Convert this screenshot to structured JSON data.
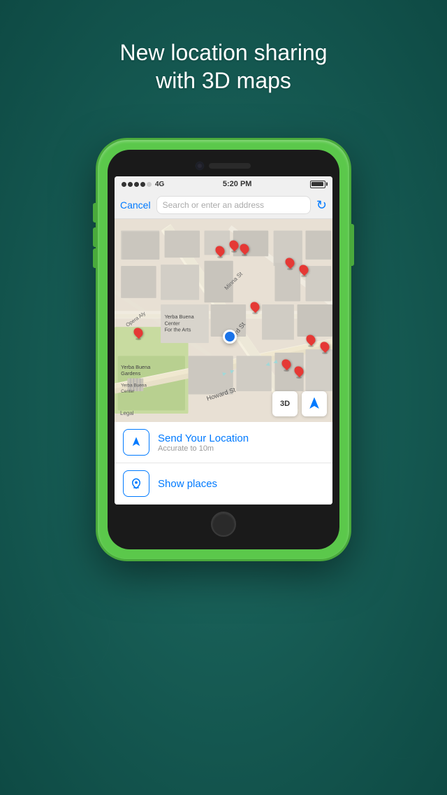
{
  "background": {
    "color": "#1a5a54"
  },
  "title": {
    "line1": "New location sharing",
    "line2": "with 3D maps"
  },
  "phone": {
    "status_bar": {
      "signal": "●●●●○",
      "network": "4G",
      "time": "5:20 PM",
      "battery": "full"
    },
    "search_bar": {
      "cancel_label": "Cancel",
      "placeholder": "Search or enter an address"
    },
    "map": {
      "legal_label": "Legal",
      "btn_3d": "3D",
      "location_icon": "➤"
    },
    "actions": [
      {
        "icon": "➤",
        "title": "Send Your Location",
        "subtitle": "Accurate to 10m"
      },
      {
        "icon": "⌃",
        "title": "Show places",
        "subtitle": ""
      }
    ]
  }
}
